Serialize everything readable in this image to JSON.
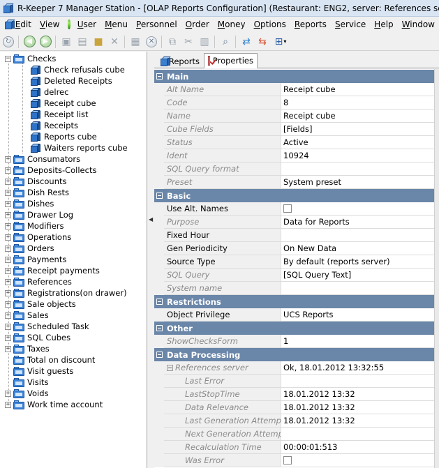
{
  "window": {
    "title": "R-Keeper 7 Manager Station - [OLAP Reports Configuration] (Restaurant: ENG2, server: References server) - [OLAP"
  },
  "menu": {
    "items": [
      {
        "label": "Edit",
        "u": "E",
        "rest": "dit"
      },
      {
        "label": "View",
        "u": "V",
        "rest": "iew"
      },
      {
        "label": "User",
        "u": "U",
        "rest": "ser"
      },
      {
        "label": "Menu",
        "u": "M",
        "rest": "enu"
      },
      {
        "label": "Personnel",
        "u": "P",
        "rest": "ersonnel"
      },
      {
        "label": "Order",
        "u": "O",
        "rest": "rder"
      },
      {
        "label": "Money",
        "u": "M",
        "rest": "oney"
      },
      {
        "label": "Options",
        "u": "O",
        "rest": "ptions"
      },
      {
        "label": "Reports",
        "u": "R",
        "rest": "eports"
      },
      {
        "label": "Service",
        "u": "S",
        "rest": "ervice"
      },
      {
        "label": "Help",
        "u": "H",
        "rest": "elp"
      },
      {
        "label": "Window",
        "u": "W",
        "rest": "indow"
      }
    ]
  },
  "toolbar": {
    "icons": [
      "refresh-icon",
      "back-icon",
      "forward-icon",
      "new-icon",
      "copy-icon",
      "open-folder-icon",
      "delete-icon",
      "save-icon",
      "cancel-icon",
      "copy-doc-icon",
      "cut-icon",
      "paste-icon",
      "find-icon",
      "export-icon",
      "import-icon",
      "grid-view-icon"
    ]
  },
  "tree": {
    "root": "Checks",
    "children": [
      "Check refusals cube",
      "Deleted Receipts",
      "delrec",
      "Receipt cube",
      "Receipt list",
      "Receipts",
      "Reports cube",
      "Waiters reports cube"
    ],
    "folders": [
      "Consumators",
      "Deposits-Collects",
      "Discounts",
      "Dish Rests",
      "Dishes",
      "Drawer Log",
      "Modifiers",
      "Operations",
      "Orders",
      "Payments",
      "Receipt payments",
      "References",
      "Registrations(on drawer)",
      "Sale objects",
      "Sales",
      "Scheduled Task",
      "SQL Cubes",
      "Taxes",
      "Total on discount",
      "Visit guests",
      "Visits",
      "Voids",
      "Work time account"
    ]
  },
  "tabs": {
    "reports": "Reports",
    "properties": "Properties"
  },
  "properties": {
    "main": {
      "title": "Main",
      "rows": [
        {
          "name": "Alt Name",
          "value": "Receipt cube"
        },
        {
          "name": "Code",
          "value": "8"
        },
        {
          "name": "Name",
          "value": "Receipt cube"
        },
        {
          "name": "Cube Fields",
          "value": "[Fields]"
        },
        {
          "name": "Status",
          "value": "Active"
        },
        {
          "name": "Ident",
          "value": "10924"
        },
        {
          "name": "SQL Query format",
          "value": ""
        },
        {
          "name": "Preset",
          "value": "System preset"
        }
      ]
    },
    "basic": {
      "title": "Basic",
      "rows": [
        {
          "name": "Use Alt. Names",
          "value": ""
        },
        {
          "name": "Purpose",
          "value": "Data for Reports"
        },
        {
          "name": "Fixed Hour",
          "value": ""
        },
        {
          "name": "Gen Periodicity",
          "value": "On New Data"
        },
        {
          "name": "Source Type",
          "value": "By default (reports server)"
        },
        {
          "name": "SQL Query",
          "value": "[SQL Query Text]"
        },
        {
          "name": "System name",
          "value": ""
        }
      ]
    },
    "restrictions": {
      "title": "Restrictions",
      "rows": [
        {
          "name": "Object Privilege",
          "value": "UCS Reports"
        }
      ]
    },
    "other": {
      "title": "Other",
      "rows": [
        {
          "name": "ShowChecksForm",
          "value": "1"
        }
      ]
    },
    "data_processing": {
      "title": "Data Processing",
      "rows": [
        {
          "name": "References server",
          "value": "Ok, 18.01.2012 13:32:55"
        },
        {
          "name": "Last Error",
          "value": ""
        },
        {
          "name": "LastStopTime",
          "value": "18.01.2012 13:32"
        },
        {
          "name": "Data Relevance",
          "value": "18.01.2012 13:32"
        },
        {
          "name": "Last Generation Attempt Time",
          "value": "18.01.2012 13:32"
        },
        {
          "name": "Next Generation Attempt Time",
          "value": ""
        },
        {
          "name": "Recalculation Time",
          "value": "00:00:01:513"
        },
        {
          "name": "Was Error",
          "value": ""
        }
      ]
    }
  }
}
